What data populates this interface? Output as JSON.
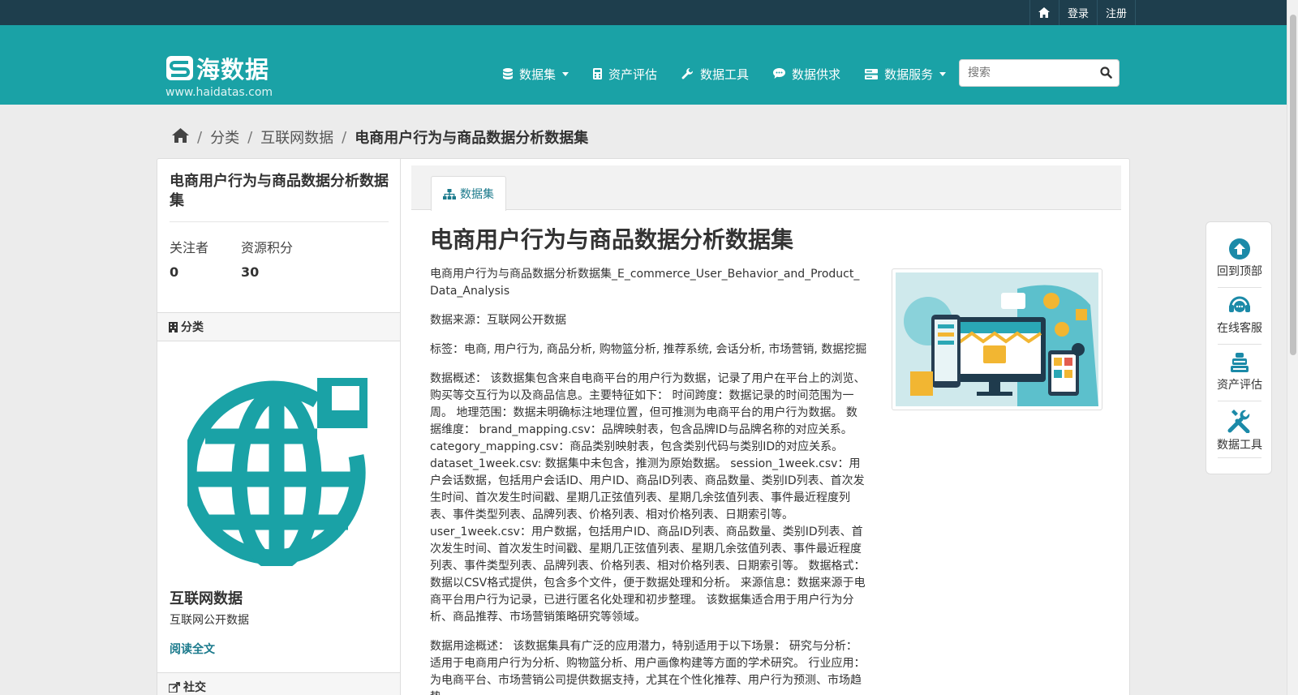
{
  "topbar": {
    "login": "登录",
    "register": "注册"
  },
  "header": {
    "logo_text": "海数据",
    "site_url": "www.haidatas.com",
    "nav": [
      {
        "label": "数据集",
        "icon": "database-icon",
        "dropdown": true
      },
      {
        "label": "资产评估",
        "icon": "calculator-icon",
        "dropdown": false
      },
      {
        "label": "数据工具",
        "icon": "wrench-icon",
        "dropdown": false
      },
      {
        "label": "数据供求",
        "icon": "chat-icon",
        "dropdown": false
      },
      {
        "label": "数据服务",
        "icon": "server-icon",
        "dropdown": true
      }
    ],
    "search_placeholder": "搜索"
  },
  "breadcrumb": {
    "items": [
      "分类",
      "互联网数据"
    ],
    "current": "电商用户行为与商品数据分析数据集"
  },
  "sidebar": {
    "title": "电商用户行为与商品数据分析数据集",
    "followers_label": "关注者",
    "followers_value": "0",
    "points_label": "资源积分",
    "points_value": "30",
    "category_header": "分类",
    "category_name": "互联网数据",
    "category_desc": "互联网公开数据",
    "read_more": "阅读全文",
    "social_header": "社交"
  },
  "main": {
    "tab_label": "数据集",
    "title": "电商用户行为与商品数据分析数据集",
    "paragraphs": [
      "电商用户行为与商品数据分析数据集_E_commerce_User_Behavior_and_Product_Data_Analysis",
      "数据来源：互联网公开数据",
      "标签：电商, 用户行为, 商品分析, 购物篮分析, 推荐系统, 会话分析, 市场营销, 数据挖掘",
      "数据概述： 该数据集包含来自电商平台的用户行为数据，记录了用户在平台上的浏览、购买等交互行为以及商品信息。主要特征如下： 时间跨度：数据记录的时间范围为一周。 地理范围：数据未明确标注地理位置，但可推测为电商平台的用户行为数据。 数据维度： brand_mapping.csv：品牌映射表，包含品牌ID与品牌名称的对应关系。 category_mapping.csv：商品类别映射表，包含类别代码与类别ID的对应关系。 dataset_1week.csv: 数据集中未包含，推测为原始数据。 session_1week.csv：用户会话数据，包括用户会话ID、用户ID、商品ID列表、商品数量、类别ID列表、首次发生时间、首次发生时间戳、星期几正弦值列表、星期几余弦值列表、事件最近程度列表、事件类型列表、品牌列表、价格列表、相对价格列表、日期索引等。 user_1week.csv：用户数据，包括用户ID、商品ID列表、商品数量、类别ID列表、首次发生时间、首次发生时间戳、星期几正弦值列表、星期几余弦值列表、事件最近程度列表、事件类型列表、品牌列表、价格列表、相对价格列表、日期索引等。 数据格式：数据以CSV格式提供，包含多个文件，便于数据处理和分析。 来源信息：数据来源于电商平台用户行为记录，已进行匿名化处理和初步整理。 该数据集适合用于用户行为分析、商品推荐、市场营销策略研究等领域。",
      "数据用途概述： 该数据集具有广泛的应用潜力，特别适用于以下场景： 研究与分析：适用于电商用户行为分析、购物篮分析、用户画像构建等方面的学术研究。 行业应用：为电商平台、市场营销公司提供数据支持，尤其在个性化推荐、用户行为预测、市场趋势"
    ]
  },
  "floating": {
    "back_to_top": "回到顶部",
    "online_service": "在线客服",
    "asset_eval": "资产评估",
    "data_tools": "数据工具"
  },
  "colors": {
    "header": "#1aa2a6",
    "topbar": "#1e3e4d",
    "accent": "#1b7a8c",
    "float_icon": "#1b8aa8"
  }
}
